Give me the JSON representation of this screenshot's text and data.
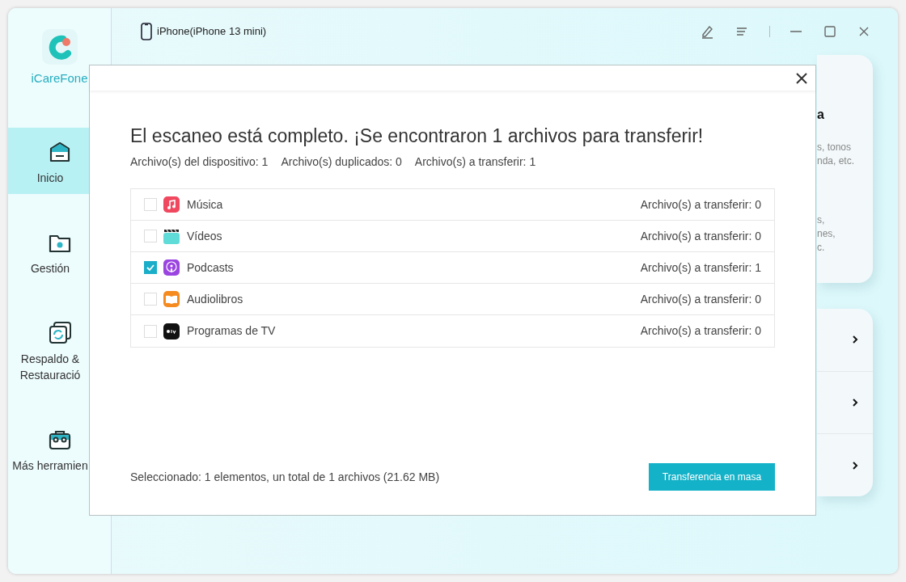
{
  "window": {
    "device": "iPhone(iPhone 13 mini)"
  },
  "sidebar": {
    "logo_text": "iCareFone",
    "items": [
      {
        "kind": "home",
        "label": "Inicio",
        "selected": true
      },
      {
        "kind": "manage",
        "label": "Gestión",
        "selected": false
      },
      {
        "kind": "backup",
        "label": "Respaldo & Restauració",
        "selected": false
      },
      {
        "kind": "tools",
        "label": "Más herramien",
        "selected": false
      }
    ]
  },
  "background_card": {
    "heading": "a",
    "lines": [
      "s, tonos",
      "nda, etc.",
      "s,",
      "nes,",
      "c."
    ]
  },
  "dialog": {
    "title": "El escaneo está completo. ¡Se encontraron 1 archivos para transferir!",
    "stats": [
      "Archivo(s) del dispositivo: 1",
      "Archivo(s) duplicados: 0",
      "Archivo(s) a transferir: 1"
    ],
    "items": [
      {
        "kind": "music",
        "label": "Música",
        "count": "Archivo(s) a transferir: 0",
        "checked": false
      },
      {
        "kind": "video",
        "label": "Vídeos",
        "count": "Archivo(s) a transferir: 0",
        "checked": false
      },
      {
        "kind": "podcast",
        "label": "Podcasts",
        "count": "Archivo(s) a transferir: 1",
        "checked": true
      },
      {
        "kind": "book",
        "label": "Audiolibros",
        "count": "Archivo(s) a transferir: 0",
        "checked": false
      },
      {
        "kind": "tv",
        "label": "Programas de TV",
        "count": "Archivo(s) a transferir: 0",
        "checked": false
      }
    ],
    "summary": "Seleccionado: 1 elementos, un total de 1 archivos (21.62 MB)",
    "button": "Transferencia en masa"
  }
}
